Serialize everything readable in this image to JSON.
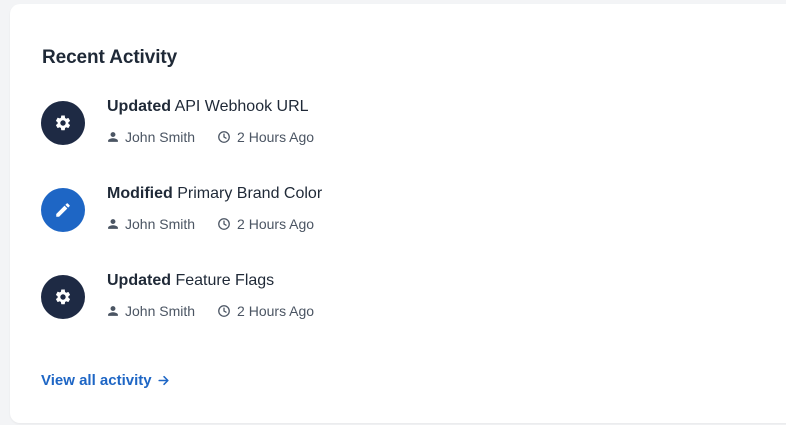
{
  "card": {
    "title": "Recent Activity",
    "view_all_label": "View all activity"
  },
  "activities": [
    {
      "action": "Updated",
      "target": "API Webhook URL",
      "user": "John Smith",
      "time": "2 Hours Ago",
      "icon": "gear-icon",
      "icon_bg": "#1e2a44"
    },
    {
      "action": "Modified",
      "target": "Primary Brand Color",
      "user": "John Smith",
      "time": "2 Hours Ago",
      "icon": "pencil-icon",
      "icon_bg": "#1e66c5"
    },
    {
      "action": "Updated",
      "target": "Feature Flags",
      "user": "John Smith",
      "time": "2 Hours Ago",
      "icon": "gear-icon",
      "icon_bg": "#1e2a44"
    }
  ],
  "colors": {
    "text_primary": "#1f2937",
    "text_secondary": "#4b5563",
    "link": "#1e66c5"
  }
}
